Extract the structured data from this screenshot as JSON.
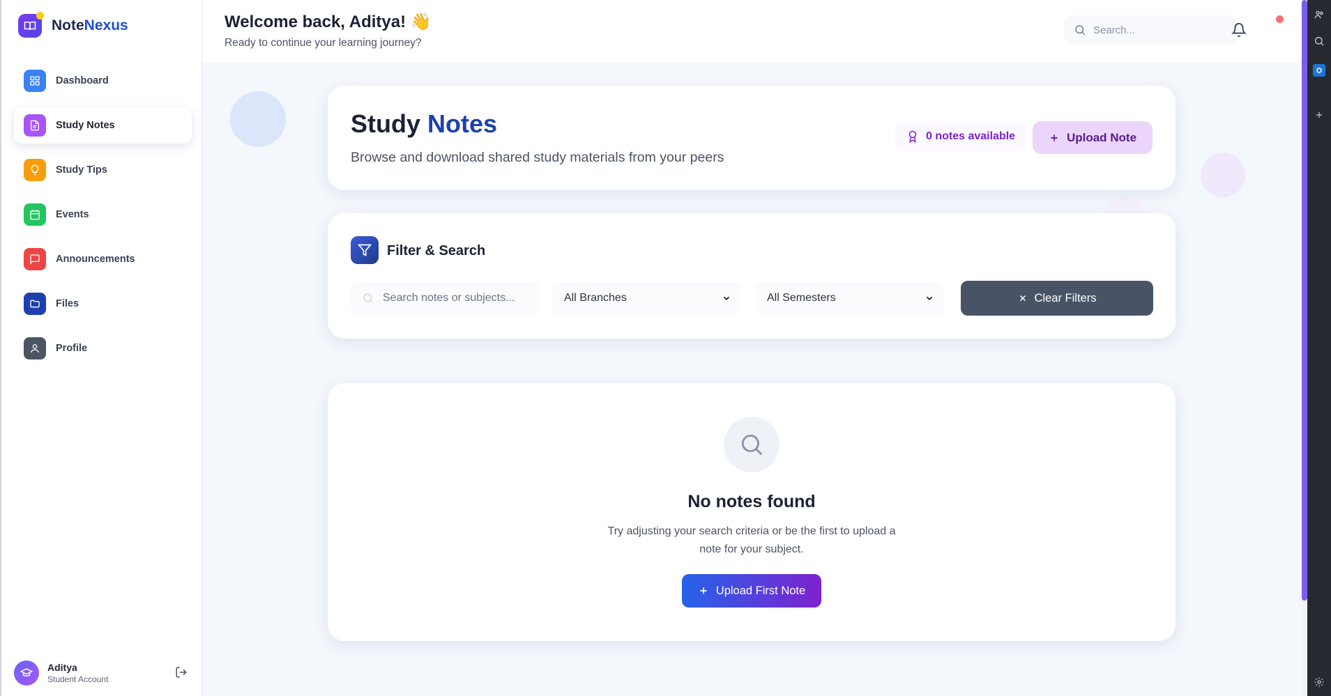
{
  "brand": {
    "name_part1": "Note",
    "name_part2": "Nexus"
  },
  "sidebar": {
    "items": [
      {
        "label": "Dashboard",
        "icon": "grid-icon",
        "color": "#3b82f6"
      },
      {
        "label": "Study Notes",
        "icon": "document-icon",
        "color": "#a855f7",
        "active": true
      },
      {
        "label": "Study Tips",
        "icon": "lightbulb-icon",
        "color": "#f59e0b"
      },
      {
        "label": "Events",
        "icon": "calendar-icon",
        "color": "#22c55e"
      },
      {
        "label": "Announcements",
        "icon": "message-icon",
        "color": "#ef4444"
      },
      {
        "label": "Files",
        "icon": "folder-icon",
        "color": "#1e40af"
      },
      {
        "label": "Profile",
        "icon": "user-icon",
        "color": "#4b5563"
      }
    ],
    "user": {
      "name": "Aditya",
      "role": "Student Account"
    }
  },
  "header": {
    "welcome": "Welcome back, Aditya! 👋",
    "subtitle": "Ready to continue your learning journey?",
    "search_placeholder": "Search..."
  },
  "hero": {
    "title_part1": "Study ",
    "title_part2": "Notes",
    "subtitle": "Browse and download shared study materials from your peers",
    "notes_count": "0 notes available",
    "upload_label": "Upload Note"
  },
  "filter": {
    "title": "Filter & Search",
    "search_placeholder": "Search notes or subjects...",
    "branch_value": "All Branches",
    "semester_value": "All Semesters",
    "clear_label": "Clear Filters"
  },
  "empty_state": {
    "title": "No notes found",
    "text": "Try adjusting your search criteria or be the first to upload a note for your subject.",
    "button_label": "Upload First Note"
  },
  "colors": {
    "accent_blue": "#1e40af",
    "accent_purple": "#7e22ce",
    "clear_button": "#485466"
  }
}
